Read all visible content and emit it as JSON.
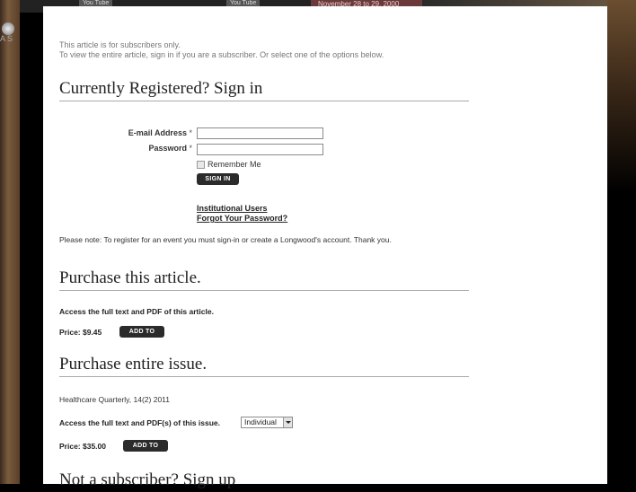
{
  "background": {
    "youtube_label_1": "You Tube",
    "youtube_label_2": "You Tube",
    "date_banner": "November 28 to 29, 2000",
    "side_label": "A S"
  },
  "intro": {
    "line1": "This article is for subscribers only.",
    "line2": "To view the entire article, sign in if you are a subscriber. Or select one of the options below."
  },
  "signin": {
    "title": "Currently Registered? Sign in",
    "email_label": "E-mail Address",
    "password_label": "Password",
    "required_mark": "*",
    "email_value": "",
    "password_value": "",
    "remember_label": "Remember Me",
    "signin_button": "SIGN IN",
    "institutional_link": "Institutional Users",
    "forgot_link": "Forgot Your Password?",
    "note": "Please note: To register for an event you must sign-in or create a Longwood's account. Thank you."
  },
  "purchase_article": {
    "title": "Purchase this article.",
    "description": "Access the full text and PDF of this article.",
    "price": "Price: $9.45",
    "button": "ADD TO CART"
  },
  "purchase_issue": {
    "title": "Purchase entire issue.",
    "issue": "Healthcare Quarterly, 14(2) 2011",
    "description": "Access the full text and PDF(s) of this issue.",
    "license_selected": "Individual",
    "price": "Price: $35.00",
    "button": "ADD TO CART"
  },
  "subscribe": {
    "title": "Not a subscriber? Sign up"
  }
}
